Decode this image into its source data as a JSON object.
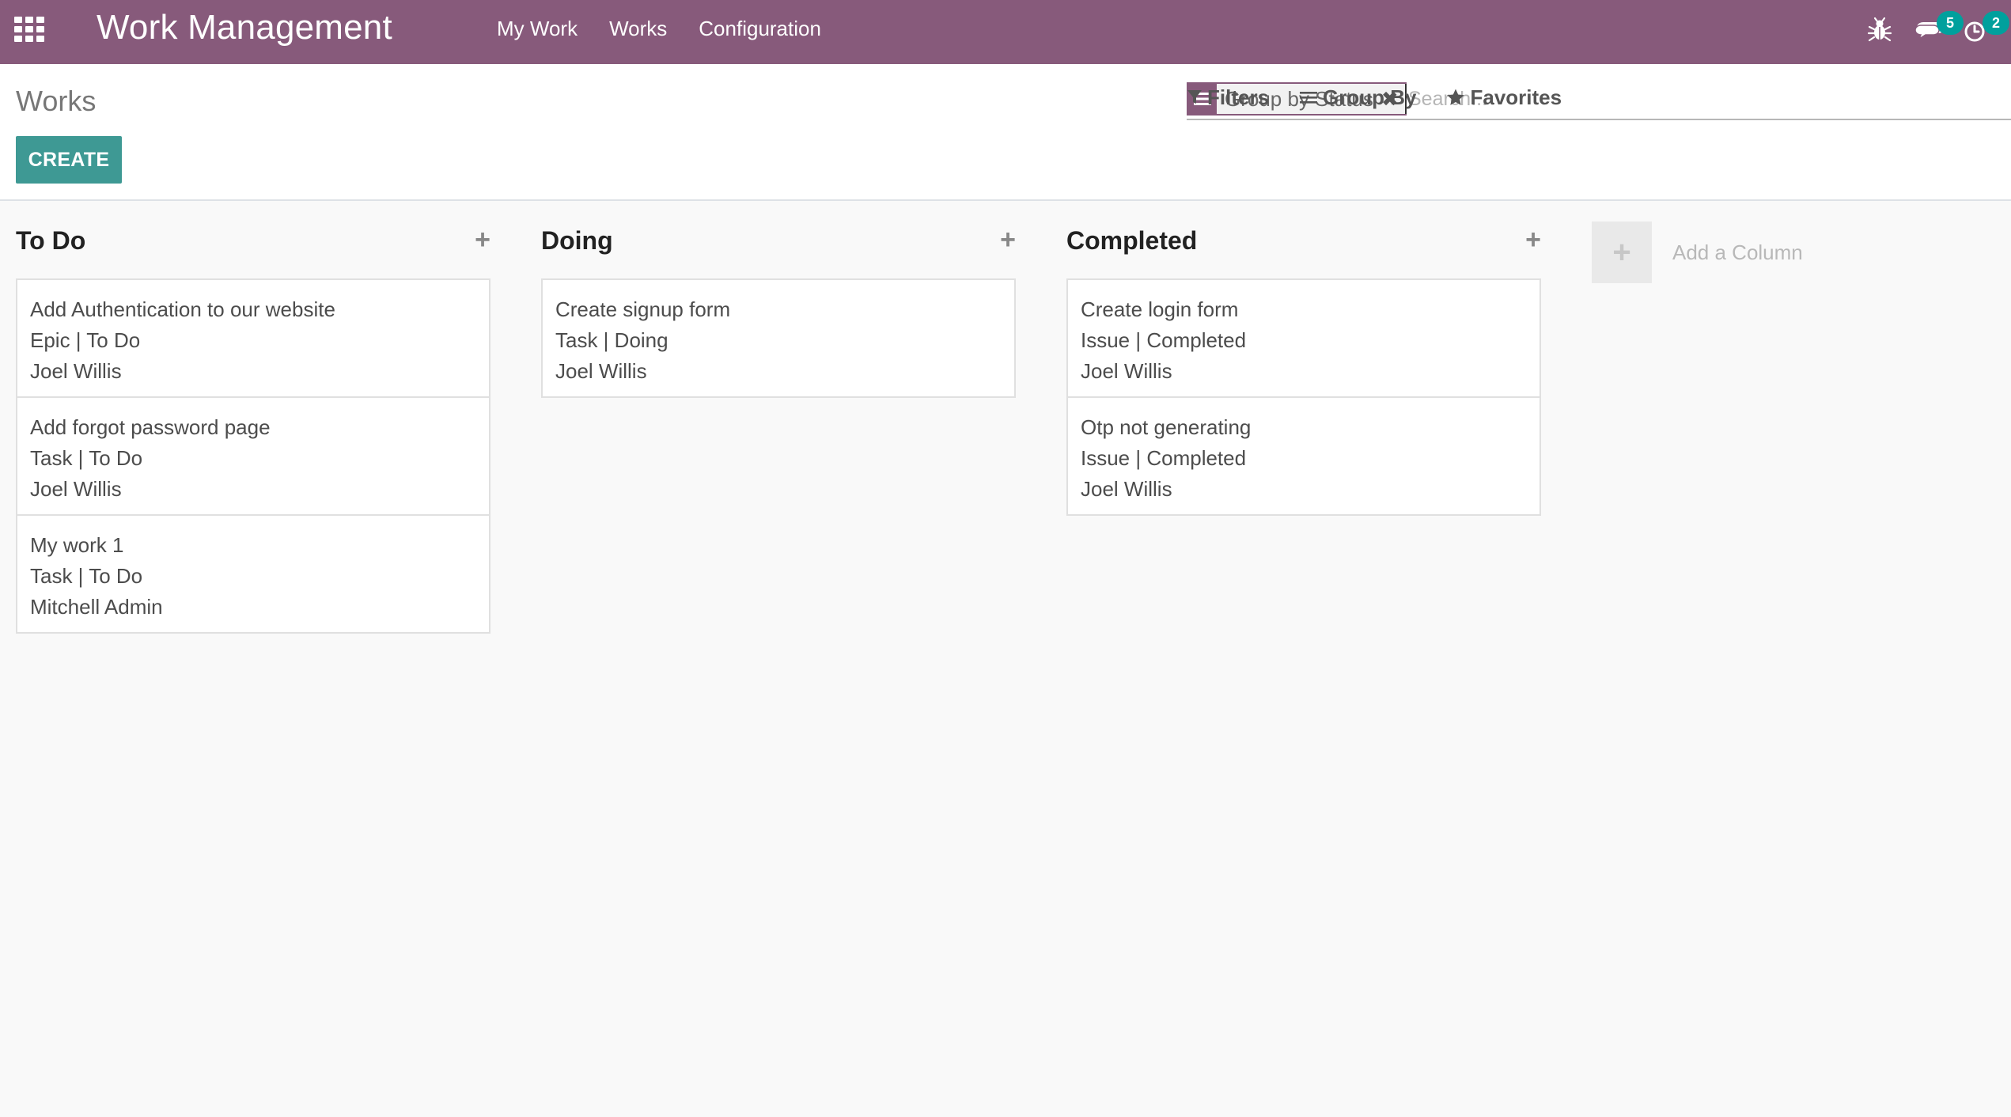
{
  "navbar": {
    "brand": "Work Management",
    "menu": [
      "My Work",
      "Works",
      "Configuration"
    ],
    "messages_count": "5",
    "activities_count": "2",
    "bg_color": "#875a7b"
  },
  "control_panel": {
    "title": "Works",
    "create_label": "CREATE",
    "facet_label": "Group by Status",
    "search_placeholder": "Search...",
    "filters_label": "Filters",
    "groupby_label": "Group By",
    "favorites_label": "Favorites"
  },
  "kanban": {
    "columns": [
      {
        "title": "To Do",
        "cards": [
          {
            "name": "Add Authentication to our website",
            "type": "Epic | To Do",
            "assignee": "Joel Willis"
          },
          {
            "name": "Add forgot password page",
            "type": "Task | To Do",
            "assignee": "Joel Willis"
          },
          {
            "name": "My work 1",
            "type": "Task | To Do",
            "assignee": "Mitchell Admin"
          }
        ]
      },
      {
        "title": "Doing",
        "cards": [
          {
            "name": "Create signup form",
            "type": "Task | Doing",
            "assignee": "Joel Willis"
          }
        ]
      },
      {
        "title": "Completed",
        "cards": [
          {
            "name": "Create login form",
            "type": "Issue | Completed",
            "assignee": "Joel Willis"
          },
          {
            "name": "Otp not generating",
            "type": "Issue | Completed",
            "assignee": "Joel Willis"
          }
        ]
      }
    ],
    "add_column_label": "Add a Column",
    "accent_color": "#3e9994"
  }
}
